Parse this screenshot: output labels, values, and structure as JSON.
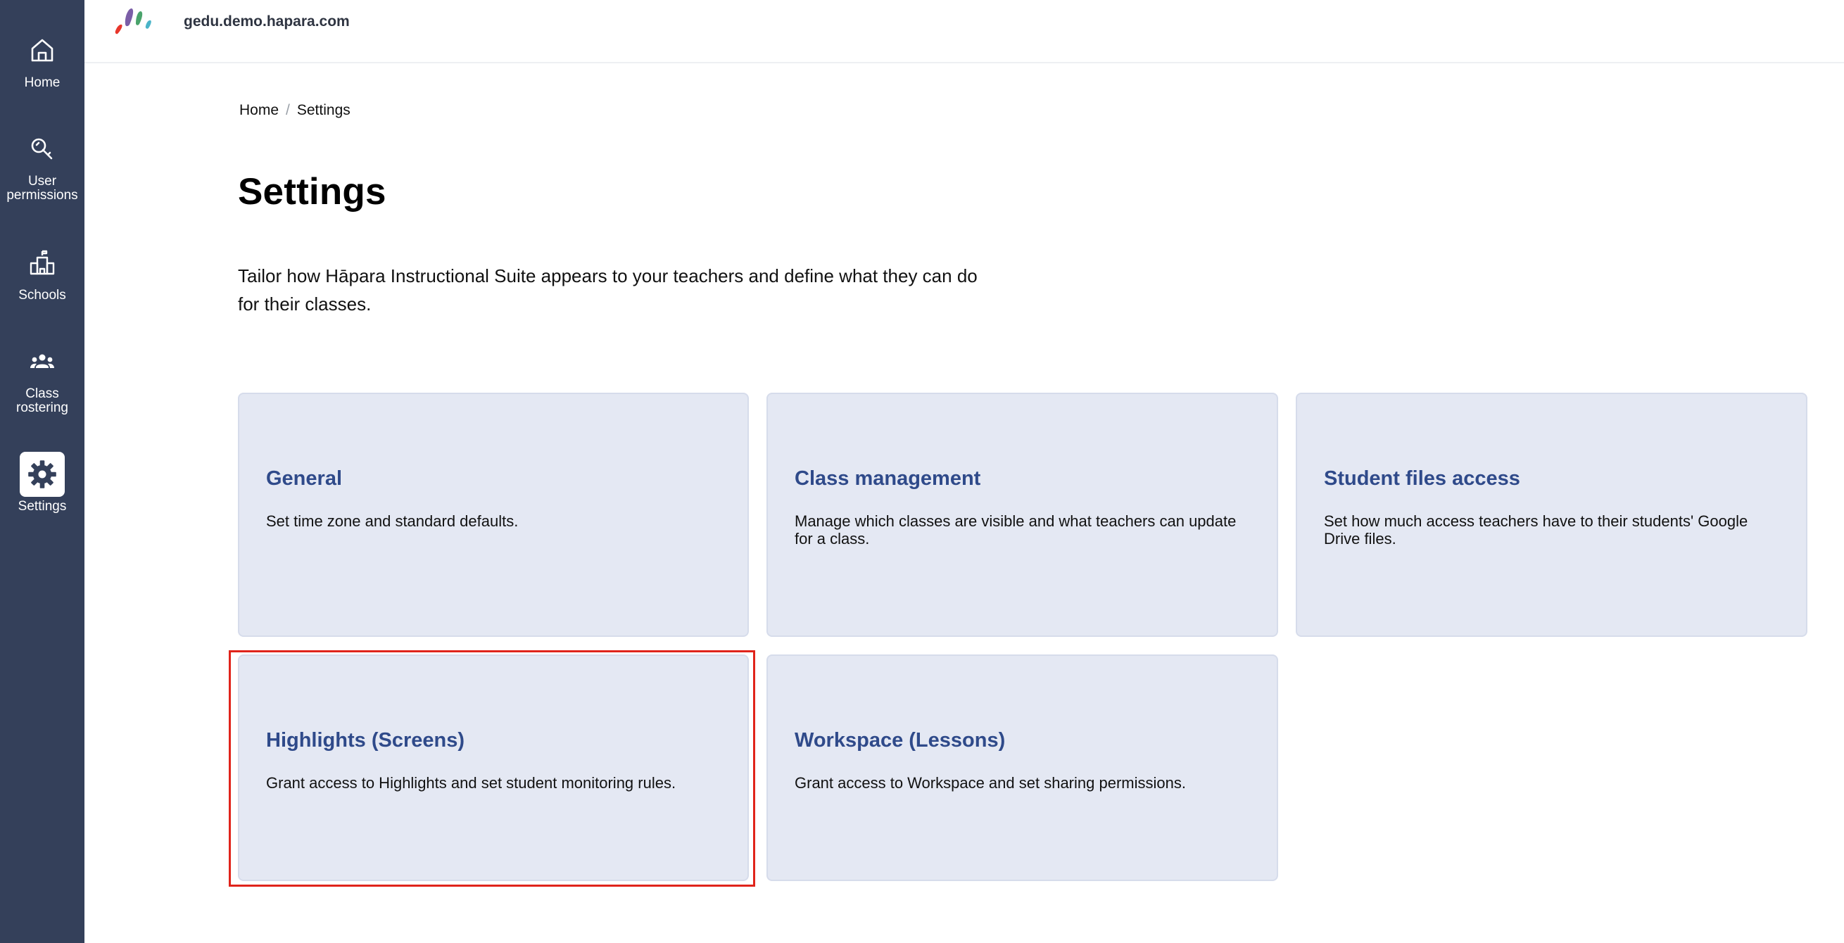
{
  "sidebar": {
    "items": [
      {
        "label": "Home",
        "icon": "home-icon"
      },
      {
        "label": "User\npermissions",
        "icon": "key-icon"
      },
      {
        "label": "Schools",
        "icon": "school-icon"
      },
      {
        "label": "Class\nrostering",
        "icon": "users-icon"
      },
      {
        "label": "Settings",
        "icon": "gear-icon",
        "active": true
      }
    ]
  },
  "header": {
    "domain": "gedu.demo.hapara.com"
  },
  "breadcrumb": {
    "home": "Home",
    "separator": "/",
    "current": "Settings"
  },
  "page": {
    "title": "Settings",
    "description": "Tailor how Hāpara Instructional Suite appears to your teachers and define what they can do for their classes."
  },
  "cards": [
    {
      "title": "General",
      "description": "Set time zone and standard defaults."
    },
    {
      "title": "Class management",
      "description": "Manage which classes are visible and what teachers can update for a class."
    },
    {
      "title": "Student files access",
      "description": "Set how much access teachers have to their students' Google Drive files."
    },
    {
      "title": "Highlights (Screens)",
      "description": "Grant access to Highlights and set student monitoring rules.",
      "highlighted": true
    },
    {
      "title": "Workspace (Lessons)",
      "description": "Grant access to Workspace and set sharing permissions."
    }
  ],
  "colors": {
    "sidebar_bg": "#34405a",
    "card_bg": "#e4e8f3",
    "card_title": "#2f4a8a",
    "highlight_border": "#e0241b"
  }
}
